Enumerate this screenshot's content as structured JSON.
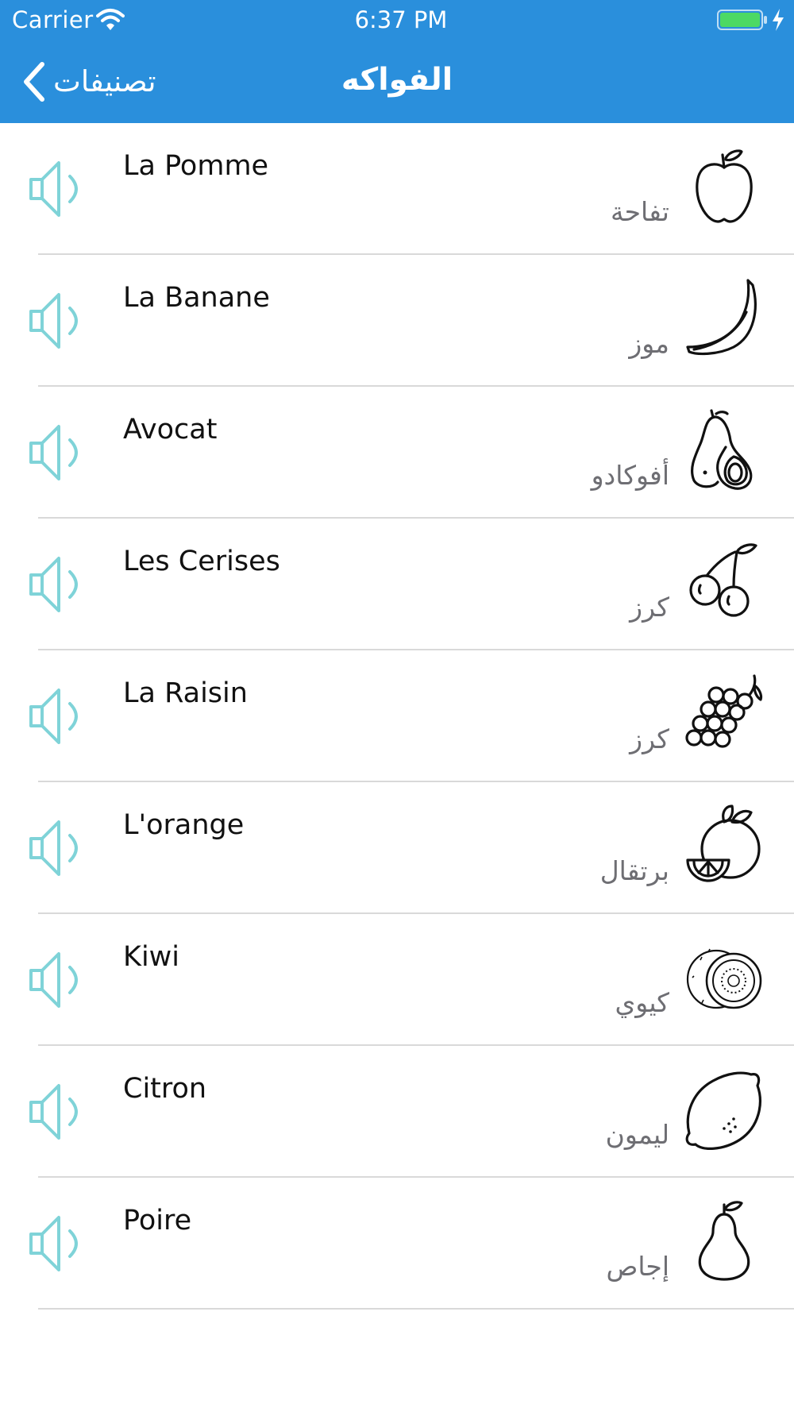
{
  "status_bar": {
    "carrier": "Carrier",
    "time": "6:37 PM",
    "battery_color": "#4cd964"
  },
  "nav": {
    "back_label": "تصنيفات",
    "title": "الفواكه"
  },
  "colors": {
    "bar": "#2a8fdc",
    "speaker": "#7fd3d8",
    "separator": "#d9d9d9"
  },
  "items": [
    {
      "french": "La Pomme",
      "arabic": "تفاحة",
      "icon": "apple-icon"
    },
    {
      "french": "La Banane",
      "arabic": "موز",
      "icon": "banana-icon"
    },
    {
      "french": "Avocat",
      "arabic": "أفوكادو",
      "icon": "avocado-icon"
    },
    {
      "french": "Les Cerises",
      "arabic": "كرز",
      "icon": "cherries-icon"
    },
    {
      "french": "La Raisin",
      "arabic": "كرز",
      "icon": "grapes-icon"
    },
    {
      "french": "L'orange",
      "arabic": "برتقال",
      "icon": "orange-icon"
    },
    {
      "french": "Kiwi",
      "arabic": "كيوي",
      "icon": "kiwi-icon"
    },
    {
      "french": "Citron",
      "arabic": "ليمون",
      "icon": "lemon-icon"
    },
    {
      "french": "Poire",
      "arabic": "إجاص",
      "icon": "pear-icon"
    }
  ]
}
